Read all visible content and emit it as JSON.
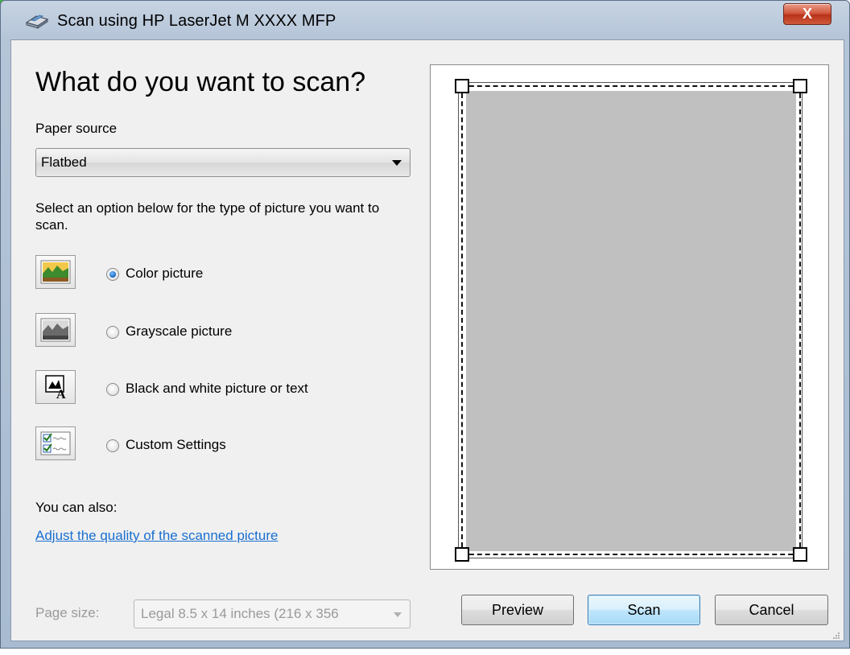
{
  "window": {
    "title": "Scan using HP LaserJet M XXXX MFP",
    "close_label": "X"
  },
  "main": {
    "heading": "What do you want to scan?",
    "paper_source_label": "Paper source",
    "paper_source_value": "Flatbed",
    "description": "Select an option below for the type of picture you want to scan.",
    "options": [
      {
        "label": "Color picture",
        "icon": "color-picture-icon",
        "selected": true
      },
      {
        "label": "Grayscale picture",
        "icon": "grayscale-picture-icon",
        "selected": false
      },
      {
        "label": "Black and white picture or text",
        "icon": "black-white-text-icon",
        "selected": false
      },
      {
        "label": "Custom Settings",
        "icon": "custom-settings-icon",
        "selected": false
      }
    ],
    "also_label": "You can also:",
    "adjust_link": "Adjust the quality of the scanned picture",
    "page_size_label": "Page size:",
    "page_size_value": "Legal 8.5 x 14 inches (216 x 356"
  },
  "buttons": {
    "preview": "Preview",
    "scan": "Scan",
    "cancel": "Cancel"
  },
  "colors": {
    "link": "#1a6fd1",
    "preview_page": "#c0c0c0"
  }
}
